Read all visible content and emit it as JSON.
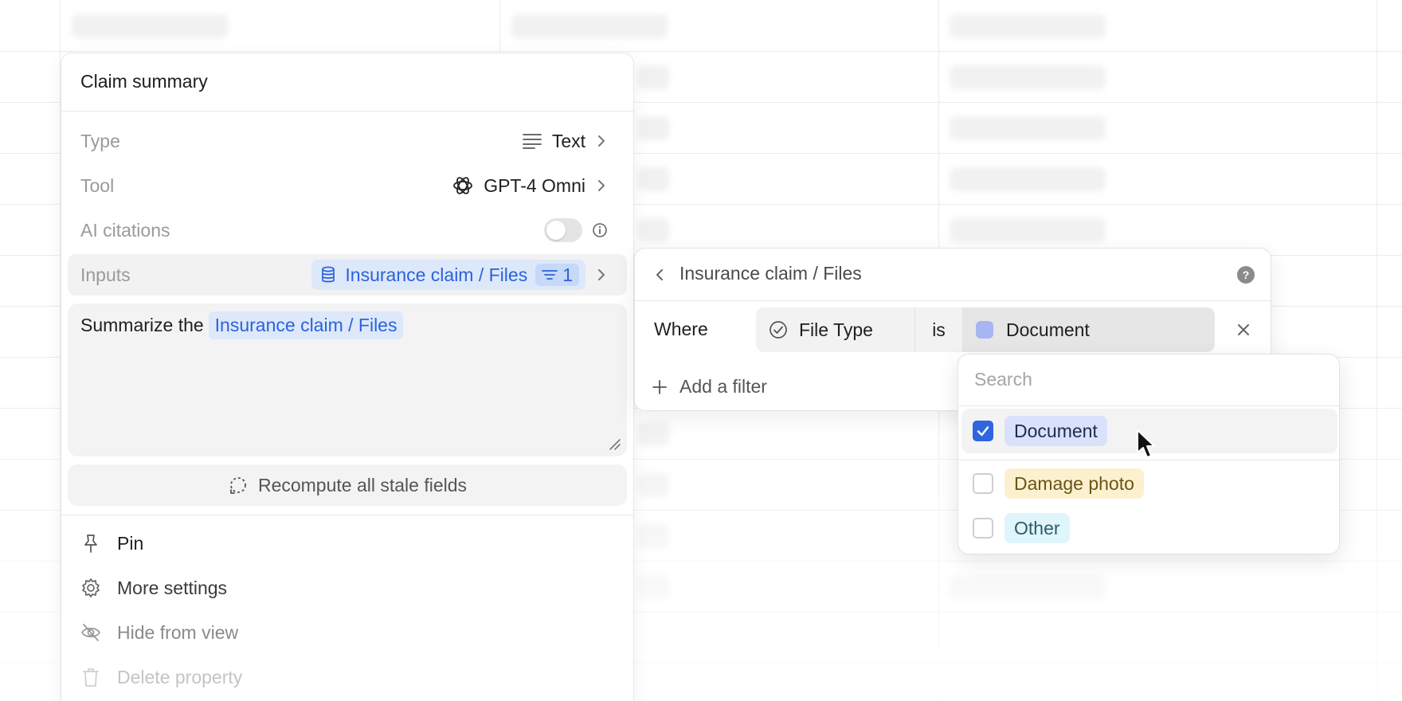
{
  "panel": {
    "title": "Claim summary",
    "properties": {
      "type": {
        "label": "Type",
        "value": "Text",
        "icon": "text-lines-icon"
      },
      "tool": {
        "label": "Tool",
        "value": "GPT-4 Omni",
        "icon": "openai-logo-icon"
      },
      "ai_citations": {
        "label": "AI citations",
        "enabled": false,
        "icon": "info-icon"
      },
      "inputs": {
        "label": "Inputs",
        "value": "Insurance claim / Files",
        "filter_count": "1",
        "icon": "database-icon"
      }
    },
    "prompt": {
      "prefix": "Summarize the",
      "mention": "Insurance claim / Files"
    },
    "recompute_label": "Recompute all stale fields",
    "menu": {
      "pin": "Pin",
      "more_settings": "More settings",
      "hide_from_view": "Hide from view",
      "delete_property": "Delete property"
    }
  },
  "filter_popover": {
    "title": "Insurance claim / Files",
    "where_label": "Where",
    "condition": {
      "field": "File Type",
      "operator": "is",
      "value": "Document"
    },
    "add_filter_label": "Add a filter"
  },
  "dropdown": {
    "search_placeholder": "Search",
    "options": [
      {
        "label": "Document",
        "checked": true,
        "chip_bg": "#d9e1fb",
        "chip_fg": "#1f2a4d"
      },
      {
        "label": "Damage photo",
        "checked": false,
        "chip_bg": "#fdf0cf",
        "chip_fg": "#6b5416"
      },
      {
        "label": "Other",
        "checked": false,
        "chip_bg": "#dff5fb",
        "chip_fg": "#2f5a66"
      }
    ]
  },
  "colors": {
    "accent_blue": "#2b63d9",
    "checkbox_blue": "#2f66e0",
    "document_swatch": "#a6b6f2"
  }
}
